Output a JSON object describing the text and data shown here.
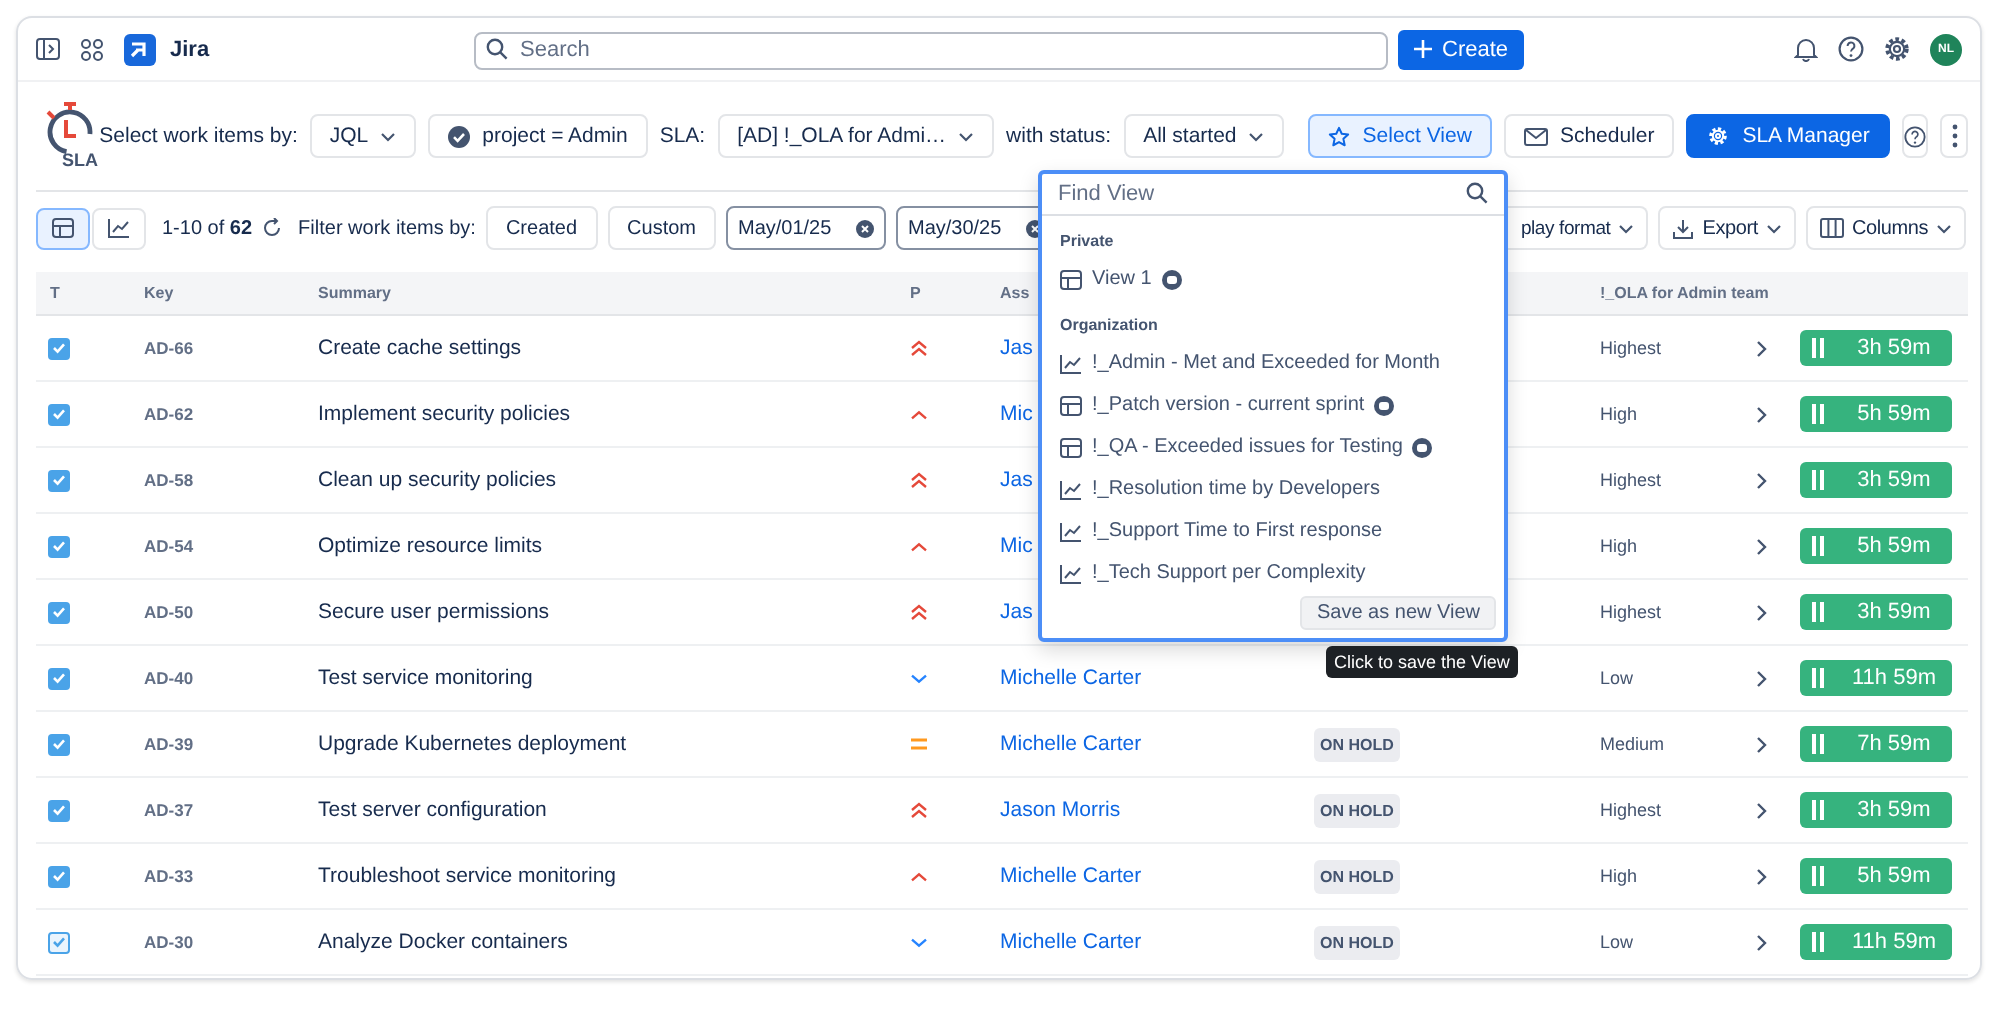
{
  "topbar": {
    "app_name": "Jira",
    "search": {
      "placeholder": "Search"
    },
    "create_button": "Create",
    "avatar": "NL"
  },
  "toolbar": {
    "logo_text": "SLA",
    "select_label": "Select work items by:",
    "mode": "JQL",
    "query": "project = Admin",
    "sla_label": "SLA:",
    "sla": "[AD] !_OLA for Admi…",
    "status_label": "with status:",
    "status": "All started",
    "buttons": [
      {
        "label": "Select View",
        "kind": "views",
        "active": true
      },
      {
        "label": "Scheduler",
        "kind": "scheduler",
        "active": false
      },
      {
        "label": "SLA Manager",
        "kind": "manager",
        "active": false
      }
    ]
  },
  "filter_bar": {
    "views": [
      {
        "kind": "table",
        "selected": true
      },
      {
        "kind": "chart",
        "selected": false
      }
    ],
    "count": "1-10 of **62**",
    "filter_label": "Filter work items by:",
    "date_field": "Created",
    "range": "Custom",
    "from": "May/01/25",
    "to": "May/30/25",
    "buttons": [
      {
        "label": "play format",
        "kind": "format"
      },
      {
        "label": "Export",
        "kind": "export"
      },
      {
        "label": "Columns",
        "kind": "columns"
      }
    ]
  },
  "table": {
    "columns": {
      "type": "T",
      "key": "Key",
      "summary": "Summary",
      "priority": "P",
      "assignee": "Ass",
      "sla": "!_OLA for Admin team"
    },
    "rows": [
      {
        "checked": true,
        "key": "AD-66",
        "summary": "Create cache settings",
        "kind": "highest",
        "assignee": "Jas",
        "priority": "Highest",
        "timer": "3h 59m"
      },
      {
        "checked": true,
        "key": "AD-62",
        "summary": "Implement security policies",
        "kind": "high",
        "assignee": "Mic",
        "priority": "High",
        "timer": "5h 59m"
      },
      {
        "checked": true,
        "key": "AD-58",
        "summary": "Clean up security policies",
        "kind": "highest",
        "assignee": "Jas",
        "priority": "Highest",
        "timer": "3h 59m"
      },
      {
        "checked": true,
        "key": "AD-54",
        "summary": "Optimize resource limits",
        "kind": "high",
        "assignee": "Mic",
        "priority": "High",
        "timer": "5h 59m"
      },
      {
        "checked": true,
        "key": "AD-50",
        "summary": "Secure user permissions",
        "kind": "highest",
        "assignee": "Jas",
        "priority": "Highest",
        "timer": "3h 59m"
      },
      {
        "checked": true,
        "key": "AD-40",
        "summary": "Test service monitoring",
        "kind": "low",
        "assignee": "Michelle Carter",
        "priority": "Low",
        "timer": "11h 59m"
      },
      {
        "checked": true,
        "key": "AD-39",
        "summary": "Upgrade Kubernetes deployment",
        "kind": "medium",
        "assignee": "Michelle Carter",
        "status": "ON HOLD",
        "priority": "Medium",
        "timer": "7h 59m"
      },
      {
        "checked": true,
        "key": "AD-37",
        "summary": "Test server configuration",
        "kind": "highest",
        "assignee": "Jason Morris",
        "status": "ON HOLD",
        "priority": "Highest",
        "timer": "3h 59m"
      },
      {
        "checked": true,
        "key": "AD-33",
        "summary": "Troubleshoot service monitoring",
        "kind": "high",
        "assignee": "Michelle Carter",
        "status": "ON HOLD",
        "priority": "High",
        "timer": "5h 59m"
      },
      {
        "checked": true,
        "focused": true,
        "key": "AD-30",
        "summary": "Analyze Docker containers",
        "kind": "low",
        "assignee": "Michelle Carter",
        "status": "ON HOLD",
        "priority": "Low",
        "timer": "11h 59m"
      }
    ]
  },
  "view_menu": {
    "search": {
      "placeholder": "Find View"
    },
    "sections": [
      {
        "title": "Private",
        "items": [
          {
            "label": "View 1",
            "kind": "table",
            "shared": true
          }
        ]
      },
      {
        "title": "Organization",
        "items": [
          {
            "label": "!_Admin - Met and Exceeded for Month",
            "kind": "chart",
            "shared": false
          },
          {
            "label": "!_Patch version - current sprint",
            "kind": "table",
            "shared": true
          },
          {
            "label": "!_QA - Exceeded issues for Testing",
            "kind": "table",
            "shared": true
          },
          {
            "label": "!_Resolution time by Developers",
            "kind": "chart",
            "shared": false
          },
          {
            "label": "!_Support Time to First response",
            "kind": "chart",
            "shared": false
          },
          {
            "label": "!_Tech Support per Complexity",
            "kind": "chart",
            "shared": false
          }
        ]
      }
    ],
    "save_button": "Save as new View",
    "tooltip": "Click to save the View"
  }
}
